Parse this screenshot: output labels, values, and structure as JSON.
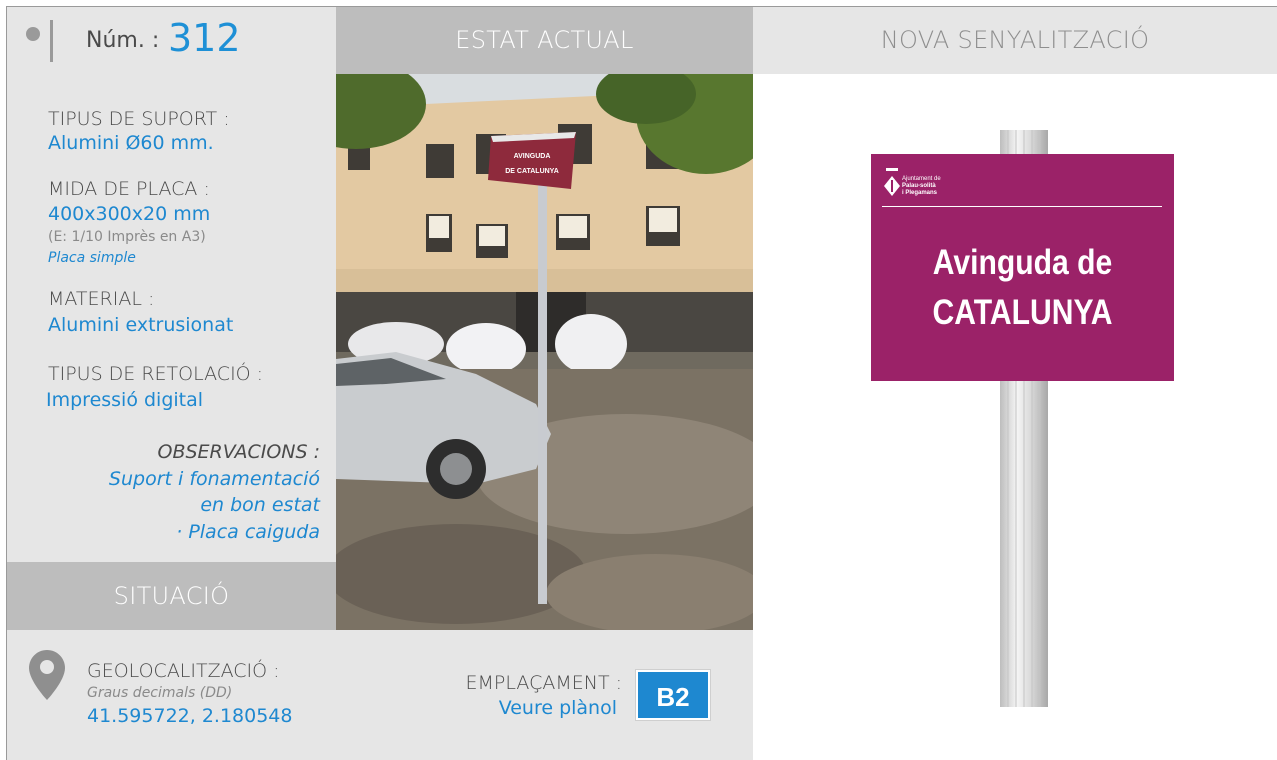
{
  "header": {
    "num_label": "Núm. :",
    "num_value": "312",
    "current_state_title": "ESTAT ACTUAL",
    "new_signage_title": "NOVA SENYALITZACIÓ"
  },
  "info": {
    "support_type_label": "TIPUS DE SUPORT :",
    "support_type_value": "Alumini Ø60 mm.",
    "plate_size_label": "MIDA DE PLACA :",
    "plate_size_value": "400x300x20 mm",
    "plate_scale_note": "(E: 1/10 Imprès en A3)",
    "plate_kind": "Placa simple",
    "material_label": "MATERIAL :",
    "material_value": "Alumini extrusionat",
    "lettering_label": "TIPUS DE RETOLACIÓ :",
    "lettering_value": "Impressió digital",
    "observations_label": "OBSERVACIONS :",
    "observations_lines": [
      "Suport i fonamentació",
      "en bon estat",
      "· Placa caiguda"
    ]
  },
  "situation": {
    "title": "SITUACIÓ",
    "geo_label": "GEOLOCALITZACIÓ :",
    "geo_format": "Graus decimals (DD)",
    "geo_value": "41.595722, 2.180548",
    "placement_label": "EMPLAÇAMENT :",
    "placement_link": "Veure plànol",
    "placement_code": "B2"
  },
  "photo": {
    "sign_line1": "AVINGUDA",
    "sign_line2": "DE CATALUNYA"
  },
  "new_sign": {
    "logo_lines": [
      "Ajuntament de",
      "Palau-solità",
      "i Plegamans"
    ],
    "line1": "Avinguda de",
    "line2": "CATALUNYA"
  },
  "colors": {
    "accent_blue": "#1e88d0",
    "sign_magenta": "#9b2268",
    "header_grey": "#bdbdbd",
    "panel_grey": "#e6e6e6"
  }
}
